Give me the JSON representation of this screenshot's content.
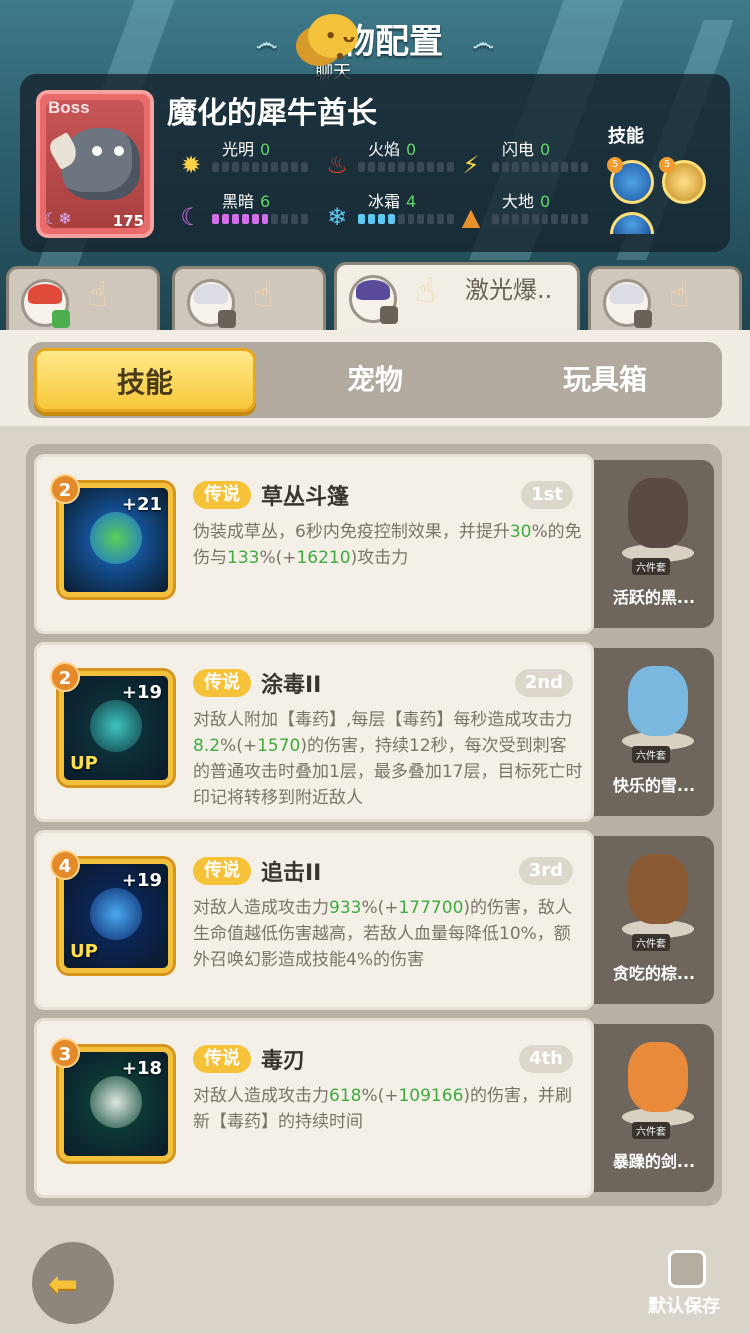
{
  "header": {
    "title": "宠物配置",
    "chat_label": "聊天"
  },
  "boss": {
    "tag": "Boss",
    "name": "魔化的犀牛酋长",
    "level": "175",
    "skills_label": "技能",
    "elements": [
      {
        "name": "光明",
        "value": "0",
        "icon": "sun-icon",
        "filled": 0
      },
      {
        "name": "火焰",
        "value": "0",
        "icon": "flame-icon",
        "filled": 0
      },
      {
        "name": "闪电",
        "value": "0",
        "icon": "lightning-icon",
        "filled": 0
      },
      {
        "name": "黑暗",
        "value": "6",
        "icon": "moon-icon",
        "filled": 6
      },
      {
        "name": "冰霜",
        "value": "4",
        "icon": "snowflake-icon",
        "filled": 4
      },
      {
        "name": "大地",
        "value": "0",
        "icon": "mountain-icon",
        "filled": 0
      }
    ]
  },
  "hero_tabs": [
    {
      "hair": "#e04a3a",
      "active": false,
      "text": ""
    },
    {
      "hair": "#e8e8ee",
      "active": false,
      "text": ""
    },
    {
      "hair": "#5a4a9a",
      "active": true,
      "text": "激光爆.."
    },
    {
      "hair": "#e8e8ee",
      "active": false,
      "text": ""
    }
  ],
  "segment": {
    "tabs": [
      "技能",
      "宠物",
      "玩具箱"
    ],
    "active": 0
  },
  "skills": [
    {
      "level": "2",
      "plus": "+21",
      "up": "",
      "rarity": "传说",
      "name": "草丛斗篷",
      "rank": "1st",
      "desc_parts": [
        {
          "t": "伪装成草丛，6秒内免疫控制效果，并提升"
        },
        {
          "t": "30",
          "g": true
        },
        {
          "t": "%的免伤与"
        },
        {
          "t": "133",
          "g": true
        },
        {
          "t": "%(+"
        },
        {
          "t": "16210",
          "g": true
        },
        {
          "t": ")攻击力"
        }
      ],
      "art_colors": [
        "#1a6fd0",
        "#5ad05a"
      ],
      "pet": {
        "name": "活跃的黑...",
        "set": "六件套",
        "color": "#5a4a44"
      }
    },
    {
      "level": "2",
      "plus": "+19",
      "up": "UP",
      "rarity": "传说",
      "name": "涂毒II",
      "rank": "2nd",
      "desc_parts": [
        {
          "t": "对敌人附加【毒药】,每层【毒药】每秒造成攻击力"
        },
        {
          "t": "8.2",
          "g": true
        },
        {
          "t": "%(+"
        },
        {
          "t": "1570",
          "g": true
        },
        {
          "t": ")的伤害，持续12秒，每次受到刺客的普通攻击时叠加1层，最多叠加17层，目标死亡时印记将转移到附近敌人"
        }
      ],
      "art_colors": [
        "#0f3a40",
        "#3ec4c0"
      ],
      "pet": {
        "name": "快乐的雪...",
        "set": "六件套",
        "color": "#7ab8e0"
      }
    },
    {
      "level": "4",
      "plus": "+19",
      "up": "UP",
      "rarity": "传说",
      "name": "追击II",
      "rank": "3rd",
      "desc_parts": [
        {
          "t": "对敌人造成攻击力"
        },
        {
          "t": "933",
          "g": true
        },
        {
          "t": "%(+"
        },
        {
          "t": "177700",
          "g": true
        },
        {
          "t": ")的伤害，敌人生命值越低伤害越高，若敌人血量每降低10%，额外召唤幻影造成技能4%的伤害"
        }
      ],
      "art_colors": [
        "#0c2a6a",
        "#4aa8f0"
      ],
      "pet": {
        "name": "贪吃的棕...",
        "set": "六件套",
        "color": "#8a5a34"
      }
    },
    {
      "level": "3",
      "plus": "+18",
      "up": "",
      "rarity": "传说",
      "name": "毒刃",
      "rank": "4th",
      "desc_parts": [
        {
          "t": "对敌人造成攻击力"
        },
        {
          "t": "618",
          "g": true
        },
        {
          "t": "%(+"
        },
        {
          "t": "109166",
          "g": true
        },
        {
          "t": ")的伤害，并刷新【毒药】的持续时间"
        }
      ],
      "art_colors": [
        "#0f4a3a",
        "#dfe8e0"
      ],
      "pet": {
        "name": "暴躁的剑...",
        "set": "六件套",
        "color": "#e88a3a"
      }
    }
  ],
  "footer": {
    "save_label": "默认保存"
  }
}
